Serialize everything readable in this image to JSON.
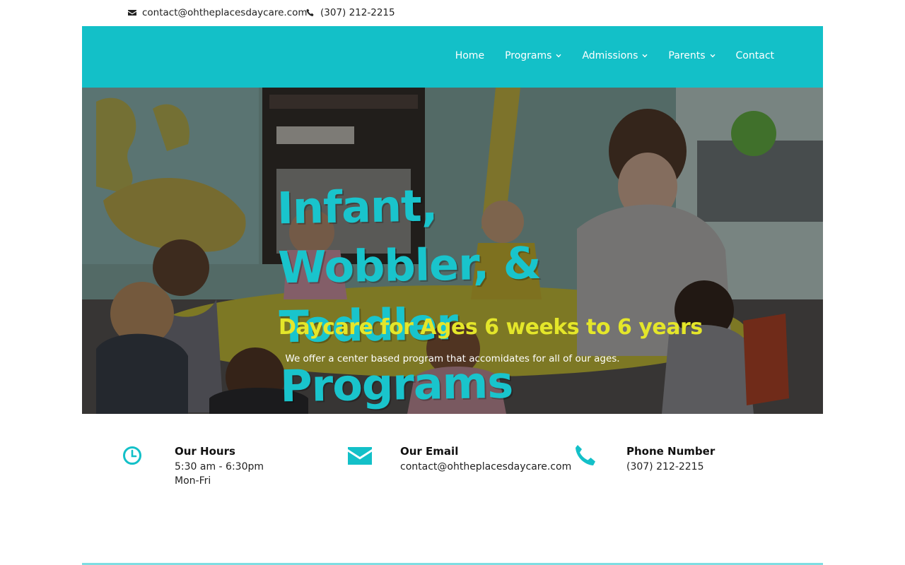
{
  "topbar": {
    "email": "contact@ohtheplacesdaycare.com",
    "phone": "(307) 212-2215"
  },
  "nav": {
    "items": [
      {
        "label": "Home",
        "has_dropdown": false
      },
      {
        "label": "Programs",
        "has_dropdown": true
      },
      {
        "label": "Admissions",
        "has_dropdown": true
      },
      {
        "label": "Parents",
        "has_dropdown": true
      },
      {
        "label": "Contact",
        "has_dropdown": false
      }
    ]
  },
  "hero": {
    "headline_line1": "Infant, Wobbler, &",
    "headline_line2": "Toddler Programs",
    "subhead": "Daycare for Ages 6 weeks to 6 years",
    "tagline": "We offer a center based program that accomidates for all of our ages."
  },
  "info": {
    "hours": {
      "title": "Our Hours",
      "line1": "5:30 am - 6:30pm",
      "line2": "Mon-Fri",
      "icon": "clock-icon"
    },
    "email": {
      "title": "Our Email",
      "line1": "contact@ohtheplacesdaycare.com",
      "icon": "envelope-icon"
    },
    "phone": {
      "title": "Phone Number",
      "line1": "(307) 212-2215",
      "icon": "phone-icon"
    }
  },
  "colors": {
    "accent": "#13c0c8",
    "headline": "#19c4cc",
    "subhead": "#e4e62a"
  }
}
